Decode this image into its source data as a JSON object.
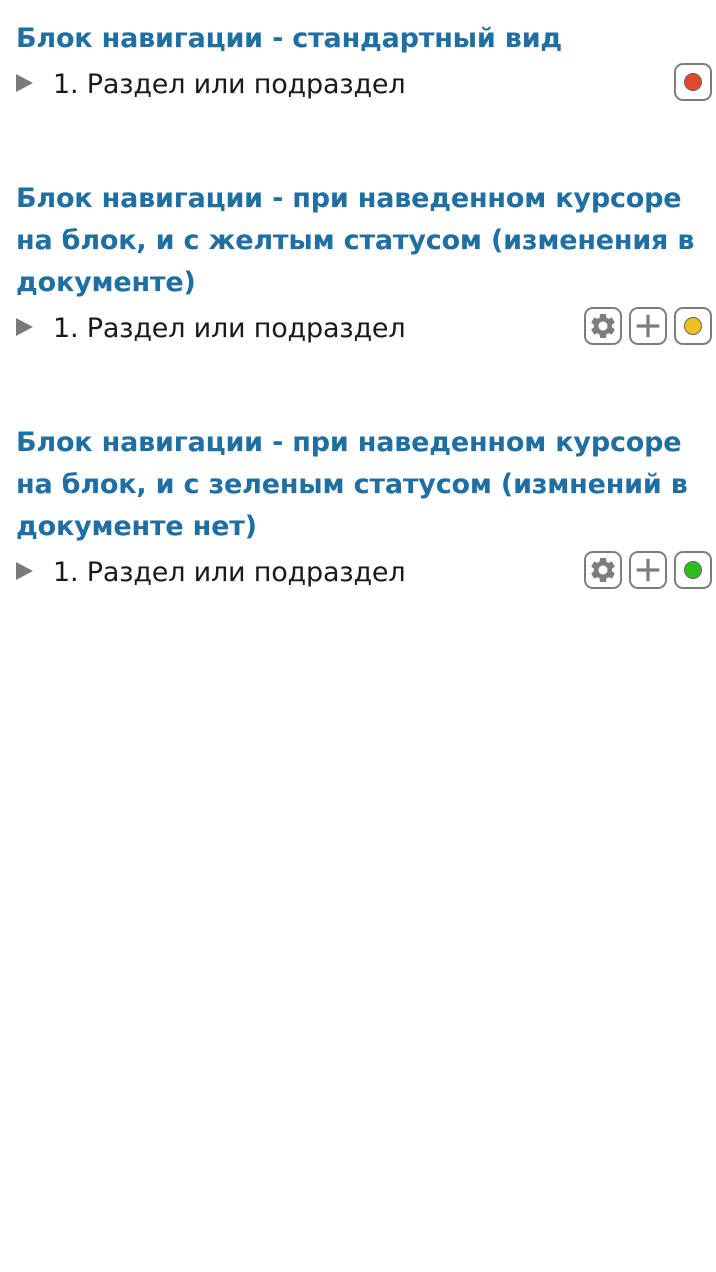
{
  "blocks": [
    {
      "title": "Блок навигации - стандартный вид",
      "item_label": "1. Раздел или подраздел",
      "show_actions": false,
      "status": "red",
      "status_color": "#e04a2a"
    },
    {
      "title": "Блок навигации - при наведенном курсоре на блок, и с желтым статусом (изменения в документе)",
      "item_label": "1. Раздел или подраздел",
      "show_actions": true,
      "status": "yellow",
      "status_color": "#f0c020"
    },
    {
      "title": "Блок навигации - при наведенном курсоре на блок, и с зеленым статусом (измнений в документе нет)",
      "item_label": "1. Раздел или подраздел",
      "show_actions": true,
      "status": "green",
      "status_color": "#2ebd1e"
    }
  ],
  "icons": {
    "expand": "triangle-right-icon",
    "settings": "gear-icon",
    "add": "plus-icon",
    "status": "status-dot-icon"
  },
  "colors": {
    "title": "#1f6fa3",
    "text": "#1a1a1a",
    "icon_gray": "#7d7d7d"
  }
}
